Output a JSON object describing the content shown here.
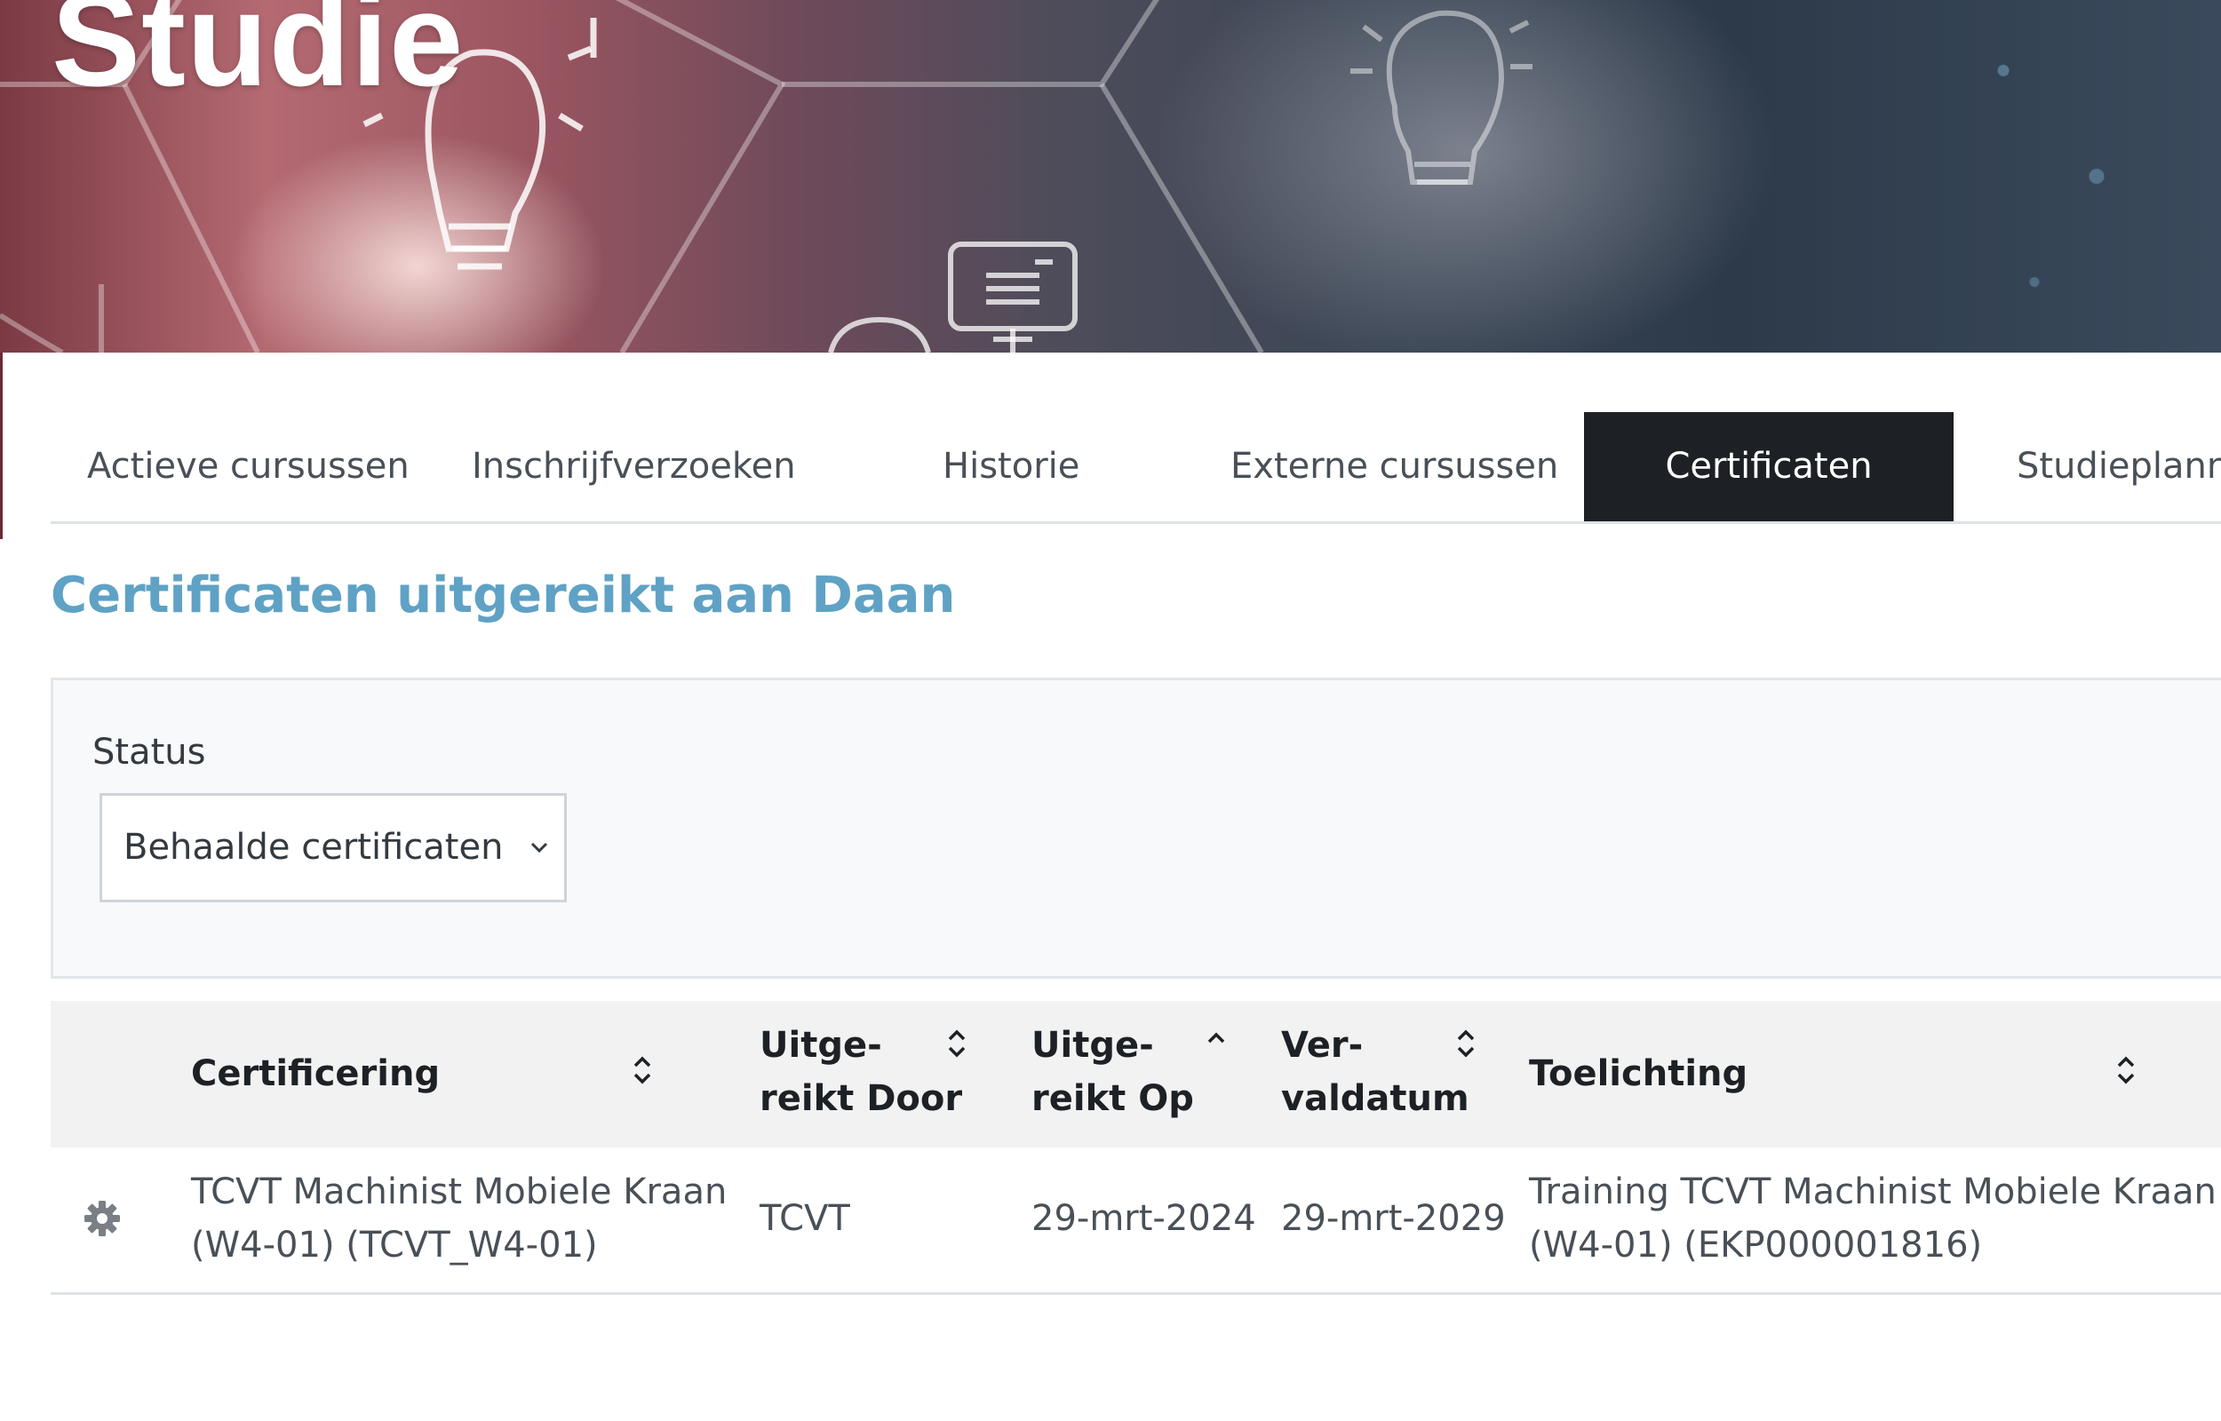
{
  "banner": {
    "title": "Studie"
  },
  "tabs": [
    {
      "label": "Actieve cursussen",
      "active": false
    },
    {
      "label": "Inschrijfverzoeken",
      "active": false
    },
    {
      "label": "Historie",
      "active": false
    },
    {
      "label": "Externe cursussen",
      "active": false
    },
    {
      "label": "Certificaten",
      "active": true
    },
    {
      "label": "Studieplann",
      "active": false
    }
  ],
  "heading": "Certificaten uitgereikt aan Daan",
  "filter": {
    "label": "Status",
    "selected": "Behaalde certificaten"
  },
  "table": {
    "columns": [
      {
        "label": "Certificering",
        "sort": "sortable"
      },
      {
        "line1": "Uitge-",
        "line2": "reikt Door",
        "sort": "sortable"
      },
      {
        "line1": "Uitge-",
        "line2": "reikt Op",
        "sort": "ascending"
      },
      {
        "line1": "Ver-",
        "line2": "valdatum",
        "sort": "sortable"
      },
      {
        "label": "Toelichting",
        "sort": "sortable"
      }
    ],
    "rows": [
      {
        "action_icon": "gear-icon",
        "certificering": [
          "TCVT Machinist Mobiele Kraan",
          "(W4-01) (TCVT_W4-01)"
        ],
        "uitgereikt_door": "TCVT",
        "uitgereikt_op": "29-mrt-2024",
        "vervaldatum": "29-mrt-2029",
        "toelichting": [
          "Training TCVT Machinist Mobiele Kraan",
          "(W4-01) (EKP000001816)"
        ]
      }
    ]
  },
  "colors": {
    "heading": "#5fa2c5",
    "active_tab_bg": "#1d2125",
    "table_header_bg": "#f2f2f2",
    "filter_bg": "#f8f9fa"
  }
}
